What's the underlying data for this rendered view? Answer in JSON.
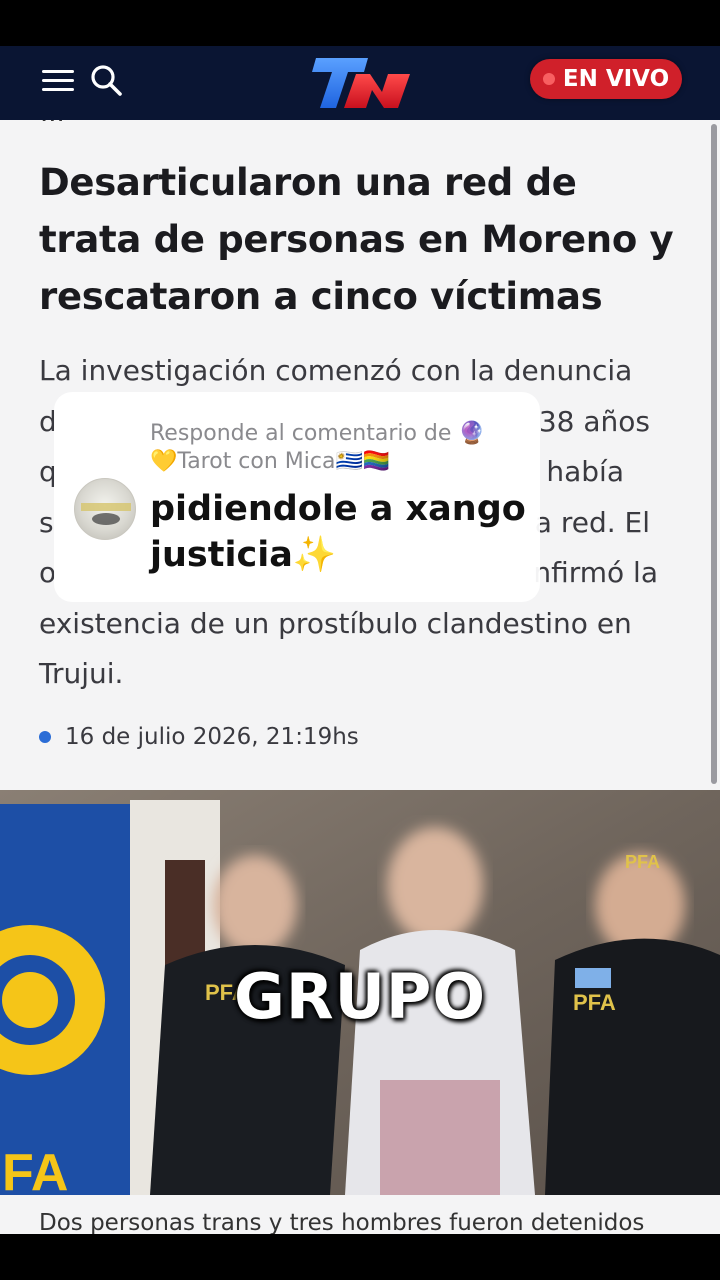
{
  "header": {
    "logo_text": "TN",
    "live_label": "EN VIVO",
    "brand_color": "#0a1533",
    "live_color": "#d0202a"
  },
  "article": {
    "breadcrumb": "...",
    "headline": "Desarticularon una red de trata de personas en Moreno y rescataron a cinco víctimas",
    "lead_lines": [
      "La investigación comenzó con la denuncia",
      "d",
      "q",
      "s",
      "o",
      "existencia de un prostíbulo clandestino en",
      "Trujui."
    ],
    "lead_right_fragments": [
      "38 años",
      "había",
      "a red. El",
      "nfirmó la"
    ],
    "date": "16 de julio 2026, 21:19hs",
    "photo_overlay_word": "GRUPO",
    "photo_badges": [
      "PFA",
      "PFA",
      "PFA"
    ],
    "caption_peek": "Dos personas trans y tres hombres fueron detenidos"
  },
  "comment_reply": {
    "meta_line1": "Responde al comentario de 🔮",
    "meta_line2": "💛Tarot con Mica🇺🇾🏳️‍🌈",
    "body": "pidiendole a xango justicia✨"
  }
}
